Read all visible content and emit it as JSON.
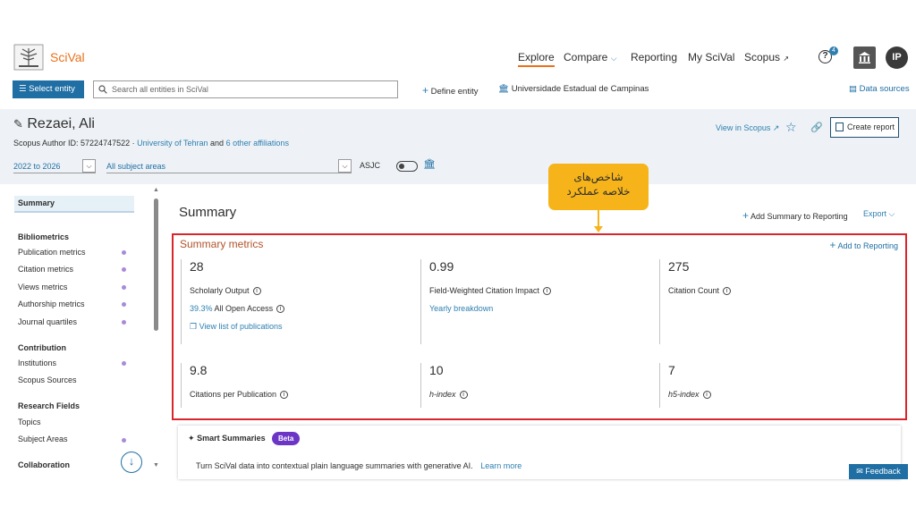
{
  "brand": {
    "name": "SciVal"
  },
  "nav": {
    "explore": "Explore",
    "compare": "Compare",
    "reporting": "Reporting",
    "my_scival": "My SciVal",
    "scopus": "Scopus",
    "help_badge": "4",
    "avatar_initials": "IP"
  },
  "toolbar": {
    "select_entity": "Select entity",
    "search_placeholder": "Search all entities in SciVal",
    "define_entity": "Define entity",
    "institution": "Universidade Estadual de Campinas",
    "data_sources": "Data sources"
  },
  "entity": {
    "name": "Rezaei, Ali",
    "author_id_label": "Scopus Author ID: 57224747522",
    "affiliation": "University of Tehran",
    "and": "and",
    "other_affiliations": "6 other affiliations",
    "year_range": "2022 to 2026",
    "subject_areas": "All subject areas",
    "asjc": "ASJC",
    "view_in_scopus": "View in Scopus",
    "create_report": "Create report"
  },
  "sidebar": {
    "summary": "Summary",
    "sections": [
      {
        "heading": "Bibliometrics",
        "items": [
          "Publication metrics",
          "Citation metrics",
          "Views metrics",
          "Authorship metrics",
          "Journal quartiles"
        ]
      },
      {
        "heading": "Contribution",
        "items": [
          "Institutions",
          "Scopus Sources"
        ]
      },
      {
        "heading": "Research Fields",
        "items": [
          "Topics",
          "Subject Areas"
        ]
      },
      {
        "heading": "Collaboration",
        "items": []
      }
    ]
  },
  "main": {
    "title": "Summary",
    "add_summary": "Add Summary to Reporting",
    "export": "Export",
    "metrics_title": "Summary metrics",
    "add_to_reporting": "Add to Reporting",
    "metrics": [
      {
        "value": "28",
        "label": "Scholarly Output",
        "sub_pct": "39.3%",
        "sub_text": "All Open Access",
        "link": "View list of publications"
      },
      {
        "value": "0.99",
        "label": "Field-Weighted Citation Impact",
        "link": "Yearly breakdown"
      },
      {
        "value": "275",
        "label": "Citation Count"
      },
      {
        "value": "9.8",
        "label": "Citations per Publication"
      },
      {
        "value": "10",
        "label": "h-index"
      },
      {
        "value": "7",
        "label": "h5-index"
      }
    ]
  },
  "smart": {
    "title": "Smart Summaries",
    "beta": "Beta",
    "description": "Turn SciVal data into contextual plain language summaries with generative AI.",
    "learn_more": "Learn more"
  },
  "feedback": "Feedback",
  "callout": {
    "line1": "شاخص‌های",
    "line2": "خلاصه عملکرد"
  },
  "colors": {
    "brand_orange": "#e9711c",
    "primary_blue": "#1f6fa4",
    "highlight_red": "#d9262c",
    "callout_yellow": "#f6b41a",
    "beta_purple": "#6b35c6"
  }
}
